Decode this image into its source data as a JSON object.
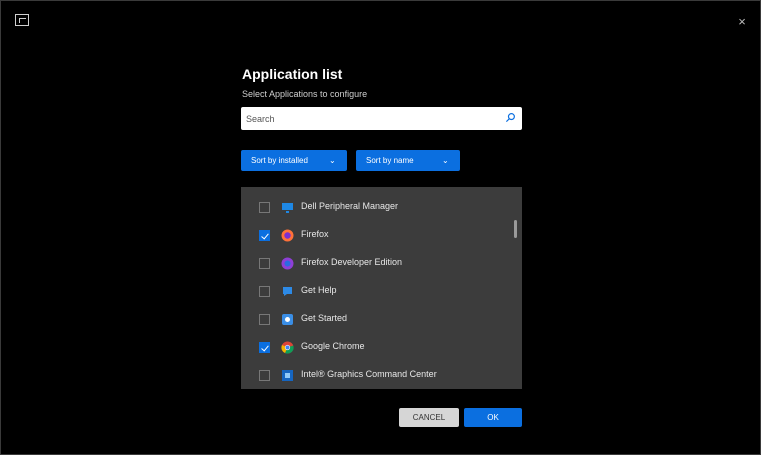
{
  "dialog": {
    "title": "Application list",
    "subtitle": "Select Applications to configure",
    "close_glyph": "×"
  },
  "search": {
    "value": "",
    "placeholder": "Search"
  },
  "toolbar": {
    "filter_label": "Sort by installed",
    "filter_chevron": "⌄",
    "sort_label": "Sort by name",
    "sort_chevron": "⌄"
  },
  "apps": [
    {
      "name": "Dell Peripheral Manager",
      "checked": false,
      "icon": "display-app-icon",
      "color": "#1e88e5"
    },
    {
      "name": "Firefox",
      "checked": true,
      "icon": "firefox-icon",
      "color": "#ff7139"
    },
    {
      "name": "Firefox Developer Edition",
      "checked": false,
      "icon": "firefox-dev-icon",
      "color": "#8e3fd6"
    },
    {
      "name": "Get Help",
      "checked": false,
      "icon": "get-help-icon",
      "color": "#2d8ae6"
    },
    {
      "name": "Get Started",
      "checked": false,
      "icon": "get-started-icon",
      "color": "#3a8ee6"
    },
    {
      "name": "Google Chrome",
      "checked": true,
      "icon": "chrome-icon",
      "color": "#4285f4"
    },
    {
      "name": "Intel® Graphics Command Center",
      "checked": false,
      "icon": "intel-graphics-icon",
      "color": "#1565c0"
    }
  ],
  "footer": {
    "cancel_label": "CANCEL",
    "ok_label": "OK"
  },
  "colors": {
    "accent": "#0b6fe0",
    "background": "#000000",
    "list_background": "#3c3c3c"
  }
}
